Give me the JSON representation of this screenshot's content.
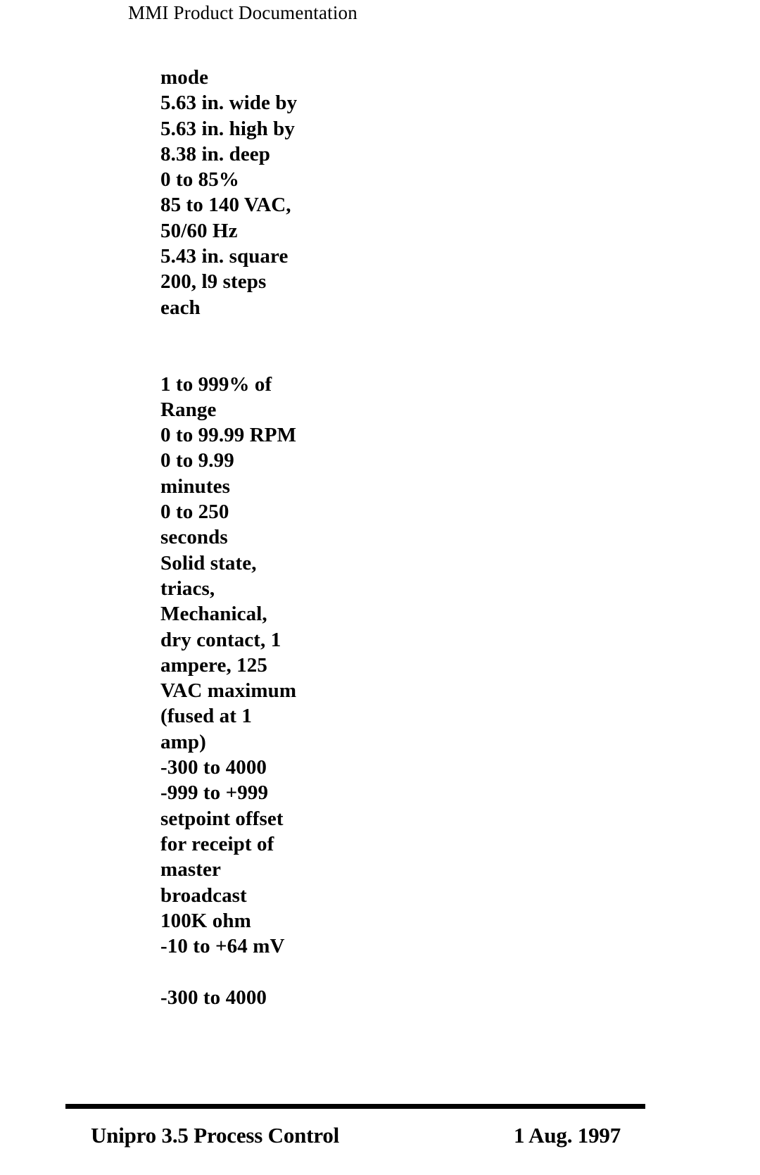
{
  "document": {
    "header": "MMI Product Documentation",
    "spec_lines": [
      "mode",
      "5.63 in. wide by",
      "5.63 in. high by",
      "8.38 in. deep",
      "0 to 85%",
      "85 to 140 VAC,",
      "50/60 Hz",
      "5.43 in. square",
      "200, l9 steps",
      "each",
      "",
      "",
      "1 to 999% of",
      "Range",
      "0 to 99.99 RPM",
      "0 to 9.99",
      "minutes",
      "0 to 250",
      "seconds",
      "Solid state,",
      "triacs,",
      "Mechanical,",
      "dry contact, 1",
      "ampere, 125",
      "VAC maximum",
      "(fused at 1",
      "amp)",
      "-300 to 4000",
      "-999 to +999",
      "setpoint offset",
      "for receipt of",
      "master",
      "broadcast",
      "100K ohm",
      "-10 to +64 mV",
      "",
      "-300 to 4000"
    ]
  },
  "footer": {
    "left": "Unipro 3.5 Process Control",
    "right": "1 Aug. 1997"
  }
}
